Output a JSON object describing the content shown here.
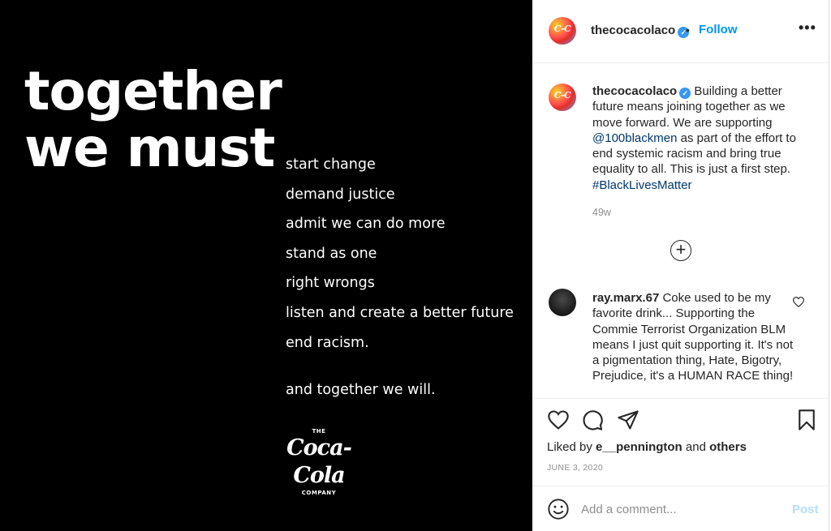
{
  "image": {
    "headline_line1": "together",
    "headline_line2": "we must",
    "phrases": [
      "start change",
      "demand justice",
      "admit we can do more",
      "stand as one",
      "right wrongs",
      "listen and create a better future",
      "end racism."
    ],
    "closing": "and together we will.",
    "logo": {
      "top": "THE",
      "script": "Coca-Cola",
      "bottom": "COMPANY"
    }
  },
  "header": {
    "username": "thecocacolaco",
    "follow_label": "Follow",
    "separator": "•",
    "more_icon": "more-options-icon"
  },
  "caption": {
    "username": "thecocacolaco",
    "text_1": "Building a better future means joining together as we move forward. We are supporting ",
    "mention": "@100blackmen",
    "text_2": " as part of the effort to end systemic racism and bring true equality to all. This is just a first step. ",
    "hashtag": "#BlackLivesMatter",
    "time": "49w"
  },
  "load_more_icon": "plus-circle-icon",
  "comment": {
    "username": "ray.marx.67",
    "text": "Coke used to be my favorite drink... Supporting the Commie Terrorist Organization BLM means I just quit supporting it. It's not a pigmentation thing, Hate, Bigotry, Prejudice, it's a HUMAN RACE thing!"
  },
  "actions": {
    "icons": [
      "heart-icon",
      "comment-icon",
      "share-icon",
      "bookmark-icon"
    ],
    "liked_by_prefix": "Liked by",
    "liked_by_user": "e__pennington",
    "liked_by_and": "and",
    "liked_by_others": "others",
    "date": "JUNE 3, 2020"
  },
  "comment_bar": {
    "placeholder": "Add a comment...",
    "post_label": "Post"
  },
  "colors": {
    "link_blue": "#0095f6",
    "mention_blue": "#00376b",
    "post_disabled": "#b2dffc",
    "muted_grey": "#8e8e8e",
    "image_bg": "#000000"
  }
}
